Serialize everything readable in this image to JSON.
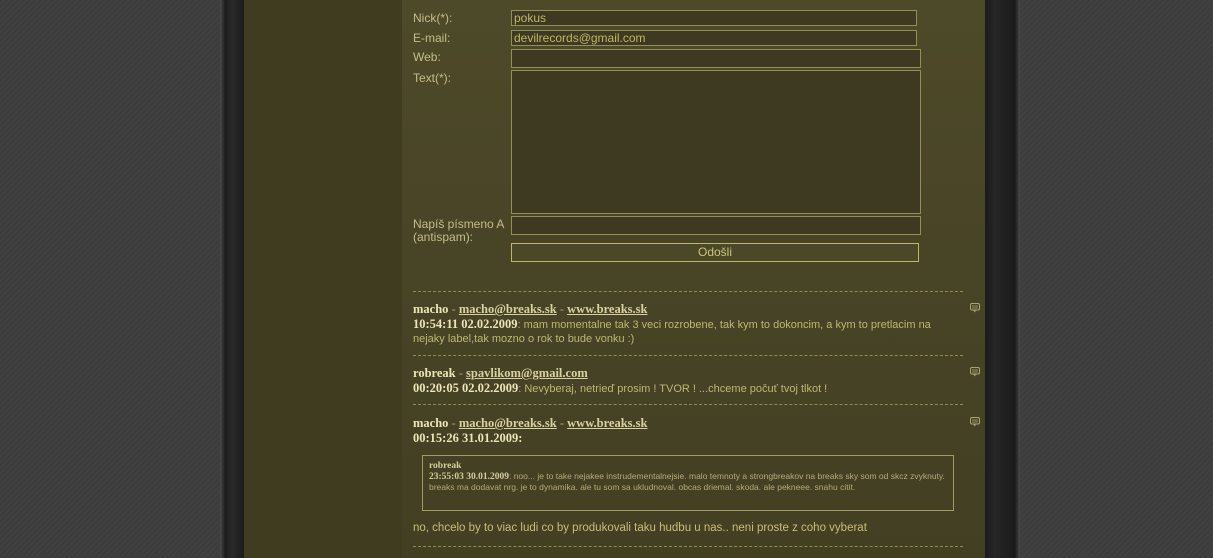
{
  "form": {
    "nick_label": "Nick(*):",
    "nick_value": "pokus",
    "email_label": "E-mail:",
    "email_value": "devilrecords@gmail.com",
    "web_label": "Web:",
    "web_value": "",
    "text_label": "Text(*):",
    "antispam_label_1": "Napíš písmeno A",
    "antispam_label_2": "(antispam):",
    "antispam_value": "",
    "submit_label": "Odošli"
  },
  "posts": [
    {
      "nick": "macho",
      "email": "macho@breaks.sk",
      "web": "www.breaks.sk",
      "time": "10:54:11 02.02.2009",
      "text": "mam momentalne tak 3 veci rozrobene, tak kym to dokoncim, a kym to pretlacim na nejaky label,tak mozno o rok to bude vonku :)"
    },
    {
      "nick": "robreak",
      "email": "spavlikom@gmail.com",
      "time": "00:20:05 02.02.2009",
      "text": "Nevyberaj, netrieď prosim ! TVOR ! ...chceme počuť tvoj tlkot !"
    },
    {
      "nick": "macho",
      "email": "macho@breaks.sk",
      "web": "www.breaks.sk",
      "time": "00:15:26 31.01.2009",
      "quote": {
        "nick": "robreak",
        "time": "23:55:03 30.01.2009",
        "text": "noo... je to take nejakee instrudementalnejsie. malo temnoty a strongbreakov na breaks sky som od skcz zvyknuty. breaks ma dodavat nrg. je to dynamika. ale tu som sa ukludnoval. obcas driemal. skoda. ale pekneee. snahu citit."
      },
      "text": "no, chcelo by to viac ludi co by produkovali taku hudbu u nas.. neni proste z coho vyberat"
    }
  ],
  "separator": " - ",
  "colon": ": ",
  "icons": {
    "reply": "speech-bubble-icon"
  },
  "colors": {
    "page_bg": "#3e3e3e",
    "content_bg": "#4a4727",
    "text": "#c6bf77",
    "border": "#938f58"
  }
}
